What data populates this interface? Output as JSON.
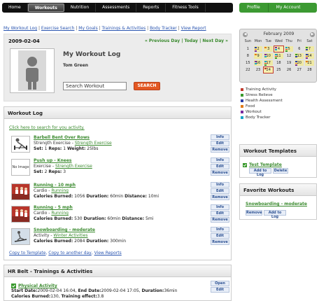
{
  "nav": {
    "tabs": [
      "Home",
      "Workouts",
      "Nutrition",
      "Assessments",
      "Reports",
      "Fitness Tools"
    ],
    "right_tabs": [
      "Profile",
      "My Account"
    ]
  },
  "links": {
    "items": [
      "My Workout Log",
      "Exercise Search",
      "My Goals",
      "Trainings & Activities",
      "Body Tracker",
      "View Report"
    ],
    "sep": " | "
  },
  "header": {
    "date": "2009-02-04",
    "prev": "« Previous Day",
    "today": "Today",
    "next": "Next Day »",
    "sep": " | ",
    "title": "My Workout Log",
    "user": "Tom Green",
    "search_value": "Search Workout",
    "search_button": "SEARCH"
  },
  "workout_log": {
    "heading": "Workout Log",
    "search_link": "Click here to search for you activity.",
    "no_image": "No Image",
    "actions": [
      "Info",
      "Edit",
      "Remove"
    ],
    "entries": [
      {
        "title": "Barbell Bent Over Rows",
        "type": "Strength Exercise - ",
        "category": "Strength Exercise",
        "stats": [
          [
            "Set:",
            "1"
          ],
          [
            "Reps:",
            "1"
          ],
          [
            "Weight:",
            "25lbs"
          ]
        ],
        "thumb": "barbell"
      },
      {
        "title": "Push up - Knees",
        "type": "Exercise - ",
        "category": "Strength Exercise",
        "stats": [
          [
            "Set:",
            "2"
          ],
          [
            "Reps:",
            "3"
          ]
        ],
        "thumb": "none"
      },
      {
        "title": "Running - 10 mph",
        "type": "Cardio - ",
        "category": "Running",
        "stats": [
          [
            "Calories Burned:",
            "1056"
          ],
          [
            "Duration:",
            "60min"
          ],
          [
            "Distance:",
            "10mi"
          ]
        ],
        "thumb": "running"
      },
      {
        "title": "Running - 5 mph",
        "type": "Cardio - ",
        "category": "Running",
        "stats": [
          [
            "Calories Burned:",
            "530"
          ],
          [
            "Duration:",
            "60min"
          ],
          [
            "Distance:",
            "5mi"
          ]
        ],
        "thumb": "running"
      },
      {
        "title": "Snowboarding - moderate",
        "type": "Activity - ",
        "category": "Winter Activities",
        "stats": [
          [
            "Calories Burned:",
            "2084"
          ],
          [
            "Duration:",
            "300min"
          ]
        ],
        "thumb": "snow"
      }
    ],
    "footer": [
      "Copy to Template",
      "Copy to another day",
      "View Reports"
    ]
  },
  "hr_belt": {
    "heading": "HR Belt - Trainings & Activities",
    "title": "Physical Activity",
    "line2": [
      [
        "Start Date:",
        "2009-02-04 16:04"
      ],
      [
        "End Date:",
        "2009-02-04 17:05"
      ],
      [
        "Duration:",
        "36min"
      ]
    ],
    "line3": [
      [
        "Calories Burned:",
        "130"
      ],
      [
        "Training effect:",
        "3.8"
      ]
    ],
    "actions": [
      "Open",
      "Edit"
    ]
  },
  "calendar": {
    "month": "February 2009",
    "days_of_week": [
      "Sun",
      "Mon",
      "Tue",
      "Wed",
      "Thu",
      "Fri",
      "Sat"
    ],
    "weeks": [
      [
        "1",
        "2",
        "3",
        "4",
        "5",
        "6",
        "7"
      ],
      [
        "8",
        "9",
        "10",
        "11",
        "12",
        "13",
        "14"
      ],
      [
        "15",
        "16",
        "17",
        "18",
        "19",
        "20",
        "21"
      ],
      [
        "22",
        "23",
        "24",
        "25",
        "26",
        "27",
        "28"
      ]
    ],
    "highlighted": [
      "2",
      "3",
      "4",
      "5",
      "7",
      "9",
      "10",
      "11",
      "13",
      "14",
      "16",
      "17",
      "20",
      "21",
      "24"
    ],
    "today": [
      "4",
      "24"
    ]
  },
  "legend": [
    {
      "label": "Training Activity",
      "color": "#c0392b"
    },
    {
      "label": "Stress Relieve",
      "color": "#3a9a2e"
    },
    {
      "label": "Health Assessment",
      "color": "#2b3ea8"
    },
    {
      "label": "Food",
      "color": "#e07b1a"
    },
    {
      "label": "Workout",
      "color": "#7a2ba0"
    },
    {
      "label": "Body Tracker",
      "color": "#1aa3c8"
    }
  ],
  "templates": {
    "heading": "Workout Templates",
    "item": "Test Template",
    "buttons": [
      "Add to Log",
      "Delete"
    ]
  },
  "favorites": {
    "heading": "Favorite Workouts",
    "item": "Snowboarding - moderate",
    "buttons": [
      "Remove",
      "Add to Log"
    ]
  }
}
